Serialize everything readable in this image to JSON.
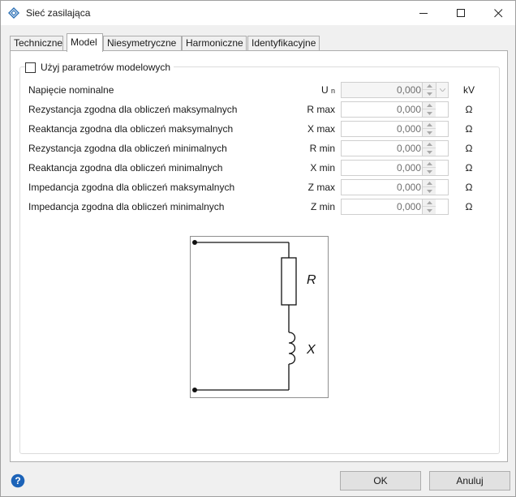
{
  "window": {
    "title": "Sieć zasilająca",
    "icon": "diamond-app-icon",
    "controls": [
      "minimize-icon",
      "maximize-icon",
      "close-icon"
    ]
  },
  "tabs": [
    {
      "label": "Techniczne",
      "active": false
    },
    {
      "label": "Model",
      "active": true
    },
    {
      "label": "Niesymetryczne",
      "active": false
    },
    {
      "label": "Harmoniczne",
      "active": false
    },
    {
      "label": "Identyfikacyjne",
      "active": false
    }
  ],
  "model": {
    "use_model_params_label": "Użyj parametrów modelowych",
    "use_model_params_checked": false,
    "rows": [
      {
        "label": "Napięcie nominalne",
        "symbol": "U",
        "symbol_sub": "n",
        "value": "0,000",
        "unit": "kV",
        "disabled": true
      },
      {
        "label": "Rezystancja zgodna dla obliczeń maksymalnych",
        "symbol": "R max",
        "symbol_sub": "",
        "value": "0,000",
        "unit": "Ω",
        "disabled": false
      },
      {
        "label": "Reaktancja zgodna dla obliczeń maksymalnych",
        "symbol": "X max",
        "symbol_sub": "",
        "value": "0,000",
        "unit": "Ω",
        "disabled": false
      },
      {
        "label": "Rezystancja zgodna dla obliczeń minimalnych",
        "symbol": "R min",
        "symbol_sub": "",
        "value": "0,000",
        "unit": "Ω",
        "disabled": false
      },
      {
        "label": "Reaktancja zgodna dla obliczeń minimalnych",
        "symbol": "X min",
        "symbol_sub": "",
        "value": "0,000",
        "unit": "Ω",
        "disabled": false
      },
      {
        "label": "Impedancja zgodna dla obliczeń maksymalnych",
        "symbol": "Z max",
        "symbol_sub": "",
        "value": "0,000",
        "unit": "Ω",
        "disabled": false
      },
      {
        "label": "Impedancja zgodna dla obliczeń minimalnych",
        "symbol": "Z min",
        "symbol_sub": "",
        "value": "0,000",
        "unit": "Ω",
        "disabled": false
      }
    ],
    "diagram": {
      "resistor_label": "R",
      "inductor_label": "X"
    }
  },
  "footer": {
    "ok_label": "OK",
    "cancel_label": "Anuluj",
    "help_icon": "question-mark-icon"
  },
  "colors": {
    "accent": "#0078d7",
    "window_bg": "#f0f0f0",
    "panel_bg": "#ffffff",
    "disabled_text": "#6d6d6d"
  }
}
